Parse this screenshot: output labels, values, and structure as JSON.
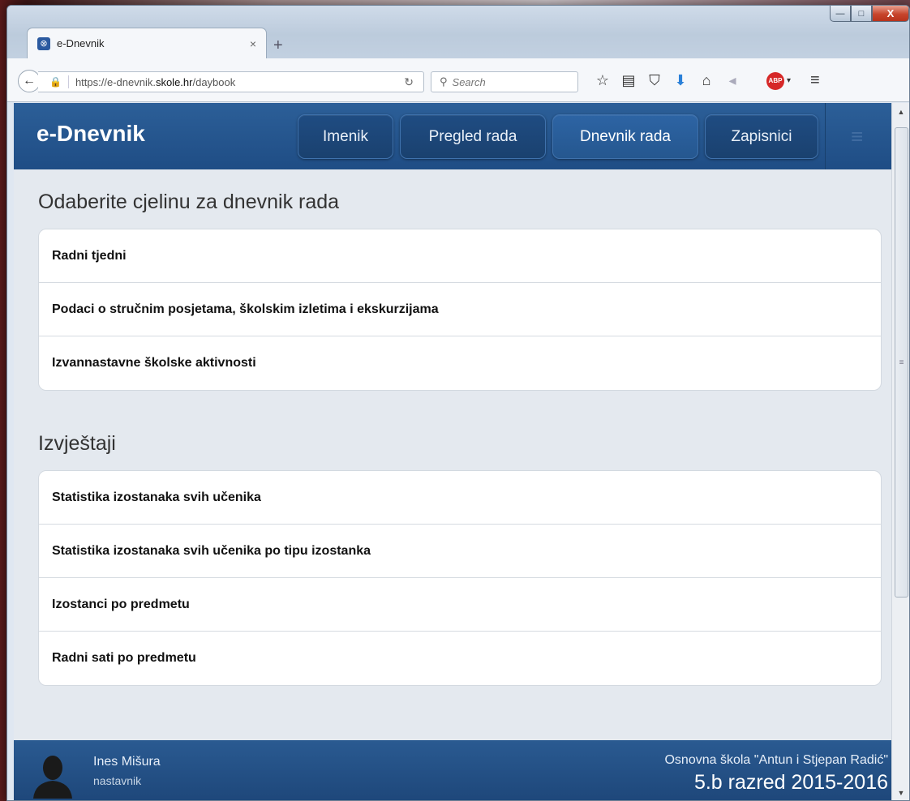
{
  "browser": {
    "tab_title": "e-Dnevnik",
    "tab_close": "×",
    "new_tab": "+",
    "url_prefix": "https://e-dnevnik.",
    "url_host": "skole.hr",
    "url_path": "/daybook",
    "search_placeholder": "Search",
    "abp_label": "ABP"
  },
  "window_controls": {
    "minimize": "—",
    "maximize": "□",
    "close": "X"
  },
  "app": {
    "brand": "e-Dnevnik",
    "nav": [
      "Imenik",
      "Pregled rada",
      "Dnevnik rada",
      "Zapisnici"
    ],
    "active_nav": "Dnevnik rada"
  },
  "sections": [
    {
      "title": "Odaberite cjelinu za dnevnik rada",
      "items": [
        "Radni tjedni",
        "Podaci o stručnim posjetama, školskim izletima i ekskurzijama",
        "Izvannastavne školske aktivnosti"
      ]
    },
    {
      "title": "Izvještaji",
      "items": [
        "Statistika izostanaka svih učenika",
        "Statistika izostanaka svih učenika po tipu izostanka",
        "Izostanci po predmetu",
        "Radni sati po predmetu"
      ]
    }
  ],
  "footer": {
    "user_name": "Ines Mišura",
    "user_role": "nastavnik",
    "school": "Osnovna škola \"Antun i Stjepan Radić\"",
    "class_year": "5.b razred 2015-2016"
  },
  "colors": {
    "header_blue": "#1f4d85",
    "page_bg": "#e4e9ef",
    "list_bg": "#ffffff"
  }
}
